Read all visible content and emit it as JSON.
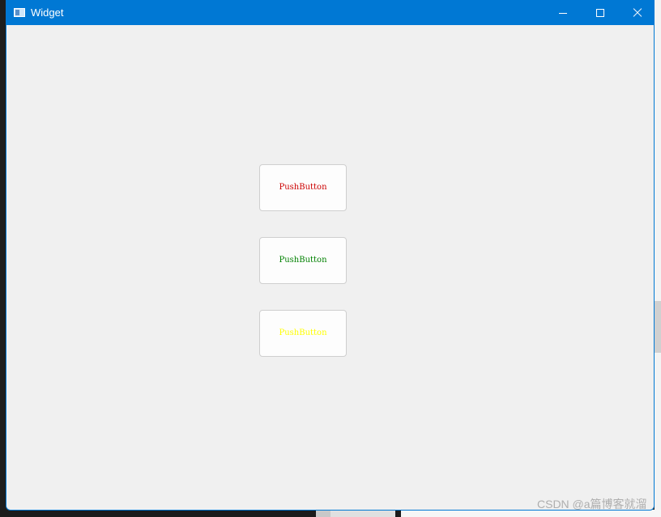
{
  "window": {
    "title": "Widget",
    "accent_color": "#0078d4",
    "controls": [
      "minimize-icon",
      "maximize-icon",
      "close-icon"
    ]
  },
  "buttons": [
    {
      "label": "PushButton",
      "text_color": "#cc0000"
    },
    {
      "label": "PushButton",
      "text_color": "#008000"
    },
    {
      "label": "PushButton",
      "text_color": "#ffff00"
    }
  ],
  "watermark": "CSDN @a篇博客就溜"
}
